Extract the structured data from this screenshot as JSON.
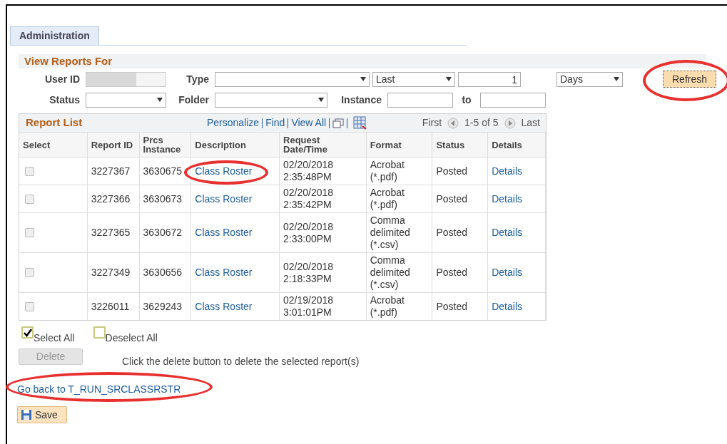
{
  "tab": {
    "label": "Administration",
    "selected": true
  },
  "filters": {
    "title": "View Reports For",
    "user_id": {
      "label": "User ID"
    },
    "type": {
      "label": "Type"
    },
    "period": {
      "value": "Last"
    },
    "count": {
      "value": "1"
    },
    "unit": {
      "value": "Days"
    },
    "refresh": {
      "label": "Refresh",
      "highlighted": true
    },
    "status": {
      "label": "Status"
    },
    "folder": {
      "label": "Folder"
    },
    "instance": {
      "label": "Instance"
    },
    "to": {
      "label": "to"
    }
  },
  "report_list": {
    "title": "Report List",
    "toolbar": [
      "Personalize",
      "Find",
      "View All"
    ],
    "nav": {
      "first": "First",
      "range": "1-5 of 5",
      "last": "Last"
    },
    "columns": [
      "Select",
      "Report ID",
      "Prcs Instance",
      "Description",
      "Request Date/Time",
      "Format",
      "Status",
      "Details"
    ],
    "rows": [
      {
        "checked": false,
        "report_id": "3227367",
        "instance": "3630675",
        "description": "Class Roster",
        "highlighted": true,
        "date": "02/20/2018",
        "time": "2:35:48PM",
        "format": "Acrobat (*.pdf)",
        "status": "Posted",
        "details": "Details"
      },
      {
        "checked": false,
        "report_id": "3227366",
        "instance": "3630673",
        "description": "Class Roster",
        "highlighted": false,
        "date": "02/20/2018",
        "time": "2:35:42PM",
        "format": "Acrobat (*.pdf)",
        "status": "Posted",
        "details": "Details"
      },
      {
        "checked": false,
        "report_id": "3227365",
        "instance": "3630672",
        "description": "Class Roster",
        "highlighted": false,
        "date": "02/20/2018",
        "time": "2:33:00PM",
        "format": "Comma delimited (*.csv)",
        "status": "Posted",
        "details": "Details"
      },
      {
        "checked": false,
        "report_id": "3227349",
        "instance": "3630656",
        "description": "Class Roster",
        "highlighted": false,
        "date": "02/20/2018",
        "time": "2:18:33PM",
        "format": "Comma delimited (*.csv)",
        "status": "Posted",
        "details": "Details"
      },
      {
        "checked": false,
        "report_id": "3226011",
        "instance": "3629243",
        "description": "Class Roster",
        "highlighted": false,
        "date": "02/19/2018",
        "time": "3:01:01PM",
        "format": "Acrobat (*.pdf)",
        "status": "Posted",
        "details": "Details"
      }
    ]
  },
  "select_all": {
    "label": "Select All",
    "checked": true
  },
  "deselect_all": {
    "label": "Deselect All",
    "checked": false
  },
  "delete": {
    "label": "Delete",
    "disabled": true
  },
  "delete_hint": "Click the delete button to delete the selected report(s)",
  "go_back": {
    "label": "Go back to T_RUN_SRCLASSRSTR",
    "highlighted": true
  },
  "save": {
    "label": "Save"
  }
}
